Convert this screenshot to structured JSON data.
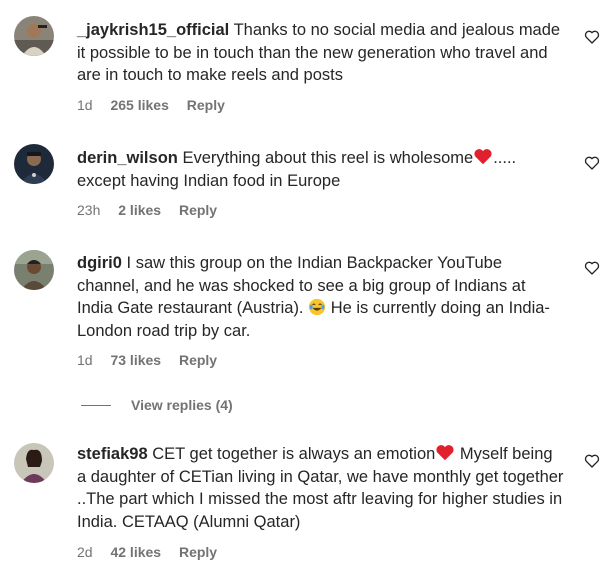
{
  "comments": [
    {
      "username": "_jaykrish15_official",
      "text": "Thanks to no social media and jealous made it possible to be in touch than the new generation who travel and are in touch to make reels and posts",
      "time": "1d",
      "likes": "265 likes",
      "reply": "Reply"
    },
    {
      "username": "derin_wilson",
      "text_before": "Everything about this reel is wholesome",
      "text_after": "..... except having Indian food in Europe",
      "time": "23h",
      "likes": "2 likes",
      "reply": "Reply"
    },
    {
      "username": "dgiri0",
      "text_before": "I saw this group on the Indian Backpacker YouTube channel, and he was shocked to see a big group of Indians at India Gate restaurant (Austria).",
      "text_after": "He is currently doing an India-London road trip by car.",
      "time": "1d",
      "likes": "73 likes",
      "reply": "Reply",
      "view_replies": "View replies (4)"
    },
    {
      "username": "stefiak98",
      "text_before": "CET get together is always an emotion",
      "text_after": " Myself being a daughter of CETian living in Qatar, we have monthly get together ..The part which I missed the most aftr leaving for higher studies in India. CETAAQ (Alumni Qatar)",
      "time": "2d",
      "likes": "42 likes",
      "reply": "Reply"
    }
  ],
  "icons": {
    "like": "heart-outline-icon",
    "emoji_heart": "red-heart-emoji",
    "emoji_laugh": "tears-of-joy-emoji"
  },
  "colors": {
    "text": "#262626",
    "secondary": "#737373",
    "heart_red": "#e0202c"
  }
}
